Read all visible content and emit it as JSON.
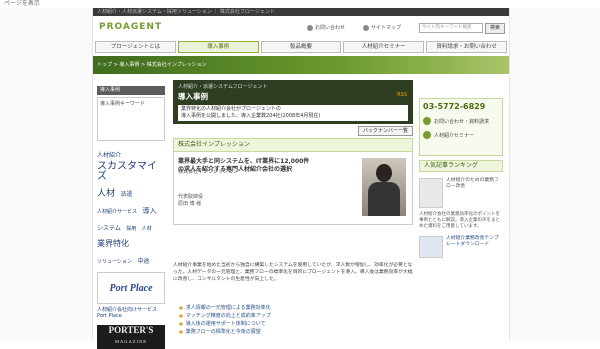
{
  "window": {
    "top_text": "ページを表示"
  },
  "header": {
    "top_strip": "人材紹介・人材派遣システム・採用ソリューション ｜ 株式会社フロージェント",
    "logo": "PROAGENT",
    "link_contact": "お問い合わせ",
    "link_sitemap": "サイトマップ",
    "search_placeholder": "サイト内キーワード検索",
    "search_button": "検索"
  },
  "nav": [
    {
      "label": "プロージェントとは"
    },
    {
      "label": "導入事例",
      "active": true
    },
    {
      "label": "製品概要"
    },
    {
      "label": "人材紹介セミナー"
    },
    {
      "label": "資料請求・お問い合わせ"
    }
  ],
  "breadcrumb": "トップ > 導入事例 > 株式会社インプレッション",
  "sidebar": {
    "heading": "導入事例",
    "box_title": "導入事例キーワード",
    "cloud": [
      "人材紹介",
      "スカスタマイズ",
      "人材",
      "派遣",
      "人材紹介サービス",
      "導入",
      "システム",
      "採用",
      "人材",
      "業界特化",
      "ソリューション",
      "中途"
    ],
    "partner_logo": "Port Place",
    "partner_text": "人材紹介会社向けサービス Port Place",
    "magazine_top": "PORTER'S",
    "magazine_bottom": "MAGAZINE"
  },
  "case": {
    "subtitle": "人材紹介・派遣システムフロージェント",
    "title": "導入事例",
    "rss": "RSS",
    "desc_line1": "業界特化の人材紹介会社がプロージェントの",
    "desc_line2": "導入事例を公開しました。導入企業数204社(2008年4月現在)",
    "back_button": "バックナンバー一覧"
  },
  "company": {
    "heading": "株式会社インプレッション",
    "headline_line1": "業界最大手と同システムを、IT業界に12,000件",
    "headline_line2": "の求人を紹介する専門人材紹介会社の選択",
    "sub": "株式会社インプレッション",
    "person_line1": "代表取締役",
    "person_line2": "原田 博 様"
  },
  "intro": "人材紹介事業を始めた当初から独自に構築したシステムを使用していたが、求人数が増加し、効率化が必要となった。人材データの一元管理と、業務フローの標準化を目的にプロージェントを導入。導入後は業務効率が大幅に改善し、コンサルタントの生産性が向上した。",
  "links": [
    "求人情報の一元管理による業務効率化",
    "マッチング精度の向上と成約率アップ",
    "導入後の運用サポート体制について",
    "業務フローの標準化と今後の展望"
  ],
  "right": {
    "phone": "03-5772-6829",
    "link_inquiry": "お問い合わせ・資料請求",
    "link_seminar": "人材紹介セミナー",
    "ranking_heading": "人気記事ランキング",
    "rank1_title": "人材紹介のための業務フロー改善",
    "rank1_desc": "人材紹介会社の業務効率化のポイントを事例とともに解説。導入企業の声をまとめた資料をご用意しています。",
    "rank2_title": "人材紹介業務改善テンプレートダウンロード"
  }
}
